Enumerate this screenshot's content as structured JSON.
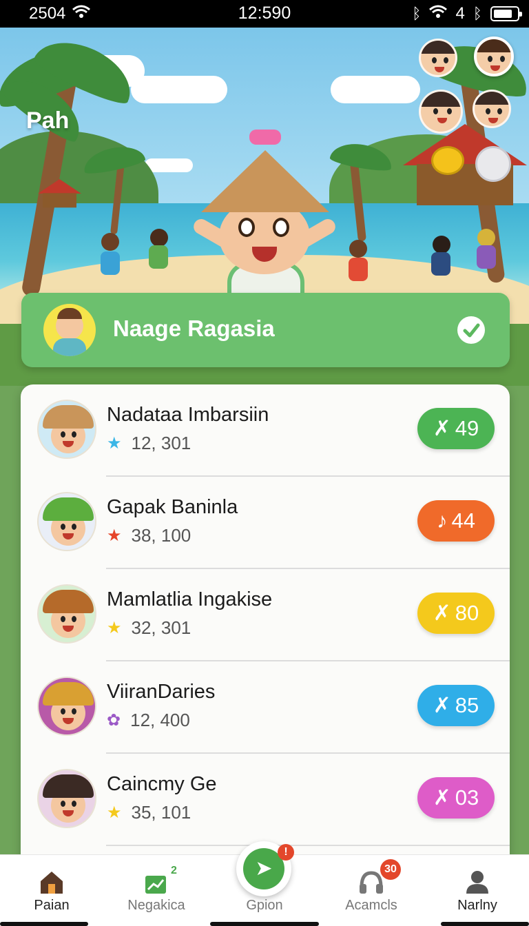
{
  "status_bar": {
    "left_text": "2504",
    "time": "12:590",
    "right_number": "4",
    "battery_level": 0.8
  },
  "hero": {
    "title": "Pah"
  },
  "highlight": {
    "name": "Naage Ragasia"
  },
  "leaderboard": [
    {
      "name": "Nadataa Imbarsiin",
      "score": "12, 301",
      "star_color": "#3bb6e6",
      "pill_icon": "✗",
      "pill_value": "49",
      "pill_color": "#4cb454",
      "hat_color": "#c9955a",
      "bg": "#cfeaf5"
    },
    {
      "name": "Gapak Baninla",
      "score": "38, 100",
      "star_color": "#e6452a",
      "pill_icon": "♪",
      "pill_value": "44",
      "pill_color": "#f06a2a",
      "hat_color": "#5cae3e",
      "bg": "#e9eef7"
    },
    {
      "name": "Mamlatlia Ingakise",
      "score": "32, 301",
      "star_color": "#f4c91c",
      "pill_icon": "✗",
      "pill_value": "80",
      "pill_color": "#f4c91c",
      "hat_color": "#b56a2a",
      "bg": "#d7efd2"
    },
    {
      "name": "ViiranDaries",
      "score": "12, 400",
      "star_color": "#9b59c6",
      "pill_icon": "✗",
      "pill_value": "85",
      "pill_color": "#2faee8",
      "hat_color": "#d9a032",
      "bg": "#b85aa8"
    },
    {
      "name": "Caincmy Ge",
      "score": "35, 101",
      "star_color": "#f4c91c",
      "pill_icon": "✗",
      "pill_value": "03",
      "pill_color": "#de5cc8",
      "hat_color": "#3b2a24",
      "bg": "#ead3e6"
    }
  ],
  "nav": {
    "items": [
      {
        "label": "Paian",
        "icon": "home-icon"
      },
      {
        "label": "Negakica",
        "icon": "chart-icon",
        "superscript": "2"
      },
      {
        "label": "Gpion",
        "icon": "send-icon",
        "badge": "!"
      },
      {
        "label": "Acamcls",
        "icon": "headphones-icon",
        "badge": "30"
      },
      {
        "label": "Narlny",
        "icon": "profile-icon"
      }
    ]
  },
  "colors": {
    "accent_green": "#6cc06e",
    "fab_green": "#49a84a",
    "badge_red": "#e3472b"
  }
}
